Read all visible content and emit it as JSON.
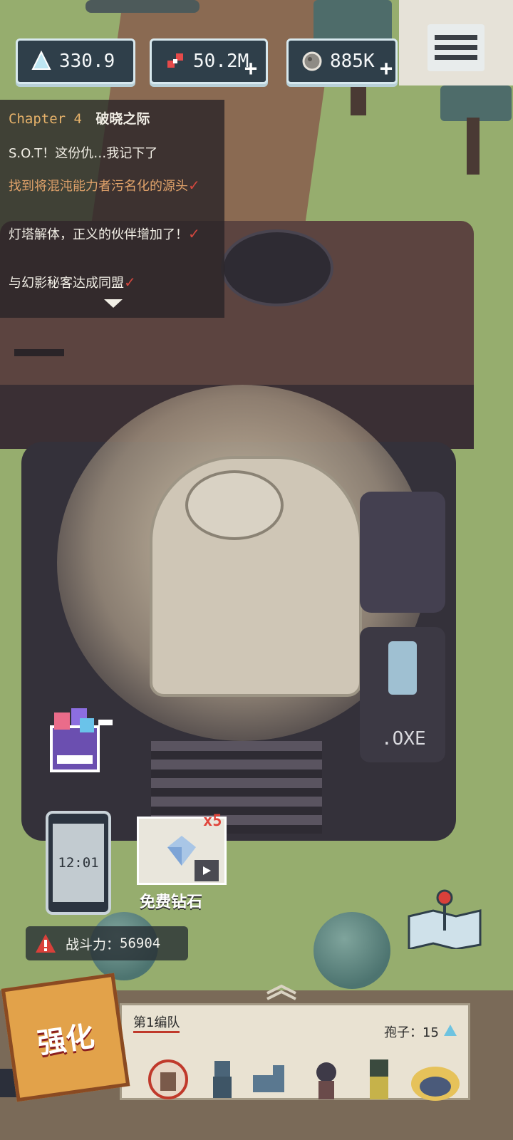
{
  "resources": [
    {
      "icon": "crystal-icon",
      "value": "330.9",
      "has_plus": false
    },
    {
      "icon": "gear-parts-icon",
      "value": "50.2M",
      "has_plus": true
    },
    {
      "icon": "ore-icon",
      "value": "885K",
      "has_plus": true
    }
  ],
  "quest": {
    "chapter": "Chapter 4",
    "chapter_name": "破晓之际",
    "items": [
      {
        "text": "S.O.T！这份仇…我记下了",
        "done": false,
        "style": "white"
      },
      {
        "text": "找到将混沌能力者污名化的源头",
        "done": true,
        "style": "orange"
      },
      {
        "text": "灯塔解体，正义的伙伴增加了！",
        "done": true,
        "style": "white"
      },
      {
        "text": "与幻影秘客达成同盟",
        "done": true,
        "style": "white"
      }
    ]
  },
  "machine": {
    "label": ".OXE"
  },
  "phone": {
    "time": "12:01"
  },
  "free_diamond": {
    "label": "免费钻石",
    "multiplier": "x5"
  },
  "combat_power": {
    "label": "战斗力：",
    "value": "56904"
  },
  "team": {
    "name": "第1编队",
    "spore_label": "孢子：",
    "spore_value": "15"
  },
  "enhance": {
    "label": "强化"
  }
}
